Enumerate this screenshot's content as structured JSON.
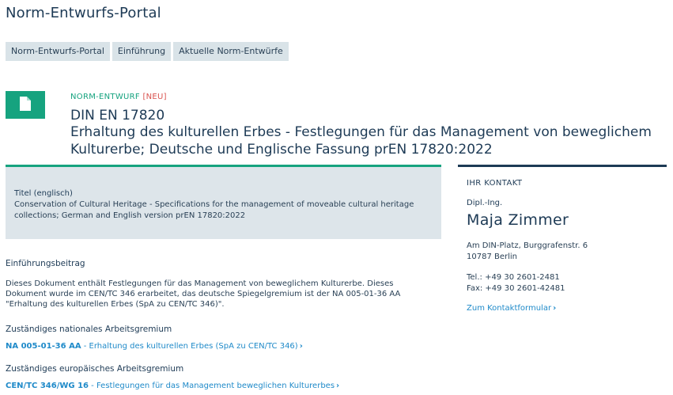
{
  "header": {
    "portal_title": "Norm-Entwurfs-Portal"
  },
  "tabs": [
    {
      "label": "Norm-Entwurfs-Portal"
    },
    {
      "label": "Einführung"
    },
    {
      "label": "Aktuelle Norm-Entwürfe"
    }
  ],
  "document": {
    "icon": "document-icon",
    "type_label": "NORM-ENTWURF",
    "new_badge": "[NEU]",
    "number": "DIN EN 17820",
    "title": "Erhaltung des kulturellen Erbes - Festlegungen für das Management von beweglichem Kulturerbe; Deutsche und Englische Fassung prEN 17820:2022"
  },
  "english_title": {
    "label": "Titel (englisch)",
    "text": "Conservation of Cultural Heritage - Specifications for the management of moveable cultural heritage collections; German and English version prEN 17820:2022"
  },
  "intro": {
    "heading": "Einführungsbeitrag",
    "text": "Dieses Dokument enthält Festlegungen für das Management von beweglichem Kulturerbe. Dieses Dokument wurde im CEN/TC 346 erarbeitet, das deutsche Spiegelgremium ist der NA 005-01-36 AA \"Erhaltung des kulturellen Erbes (SpA zu CEN/TC 346)\"."
  },
  "national_committee": {
    "heading": "Zuständiges nationales Arbeitsgremium",
    "code": "NA 005-01-36 AA",
    "name": " - Erhaltung des kulturellen Erbes (SpA zu CEN/TC 346)",
    "chevron": "›"
  },
  "european_committee": {
    "heading": "Zuständiges europäisches Arbeitsgremium",
    "code": "CEN/TC 346/WG 16",
    "name": " - Festlegungen für das Management beweglichen Kulturerbes",
    "chevron": "›"
  },
  "contact": {
    "heading": "IHR KONTAKT",
    "title": "Dipl.-Ing.",
    "name": "Maja Zimmer",
    "address_line1": "Am DIN-Platz, Burggrafenstr. 6",
    "address_line2": "10787 Berlin",
    "phone": "Tel.: +49 30 2601-2481",
    "fax": "Fax: +49 30 2601-42481",
    "form_link": "Zum Kontaktformular",
    "chevron": "›"
  },
  "colors": {
    "accent_green": "#16a37f",
    "navy": "#1d3a55",
    "link_blue": "#1f8ac9",
    "badge_red": "#d9534f",
    "panel_gray": "#dde5ea"
  }
}
